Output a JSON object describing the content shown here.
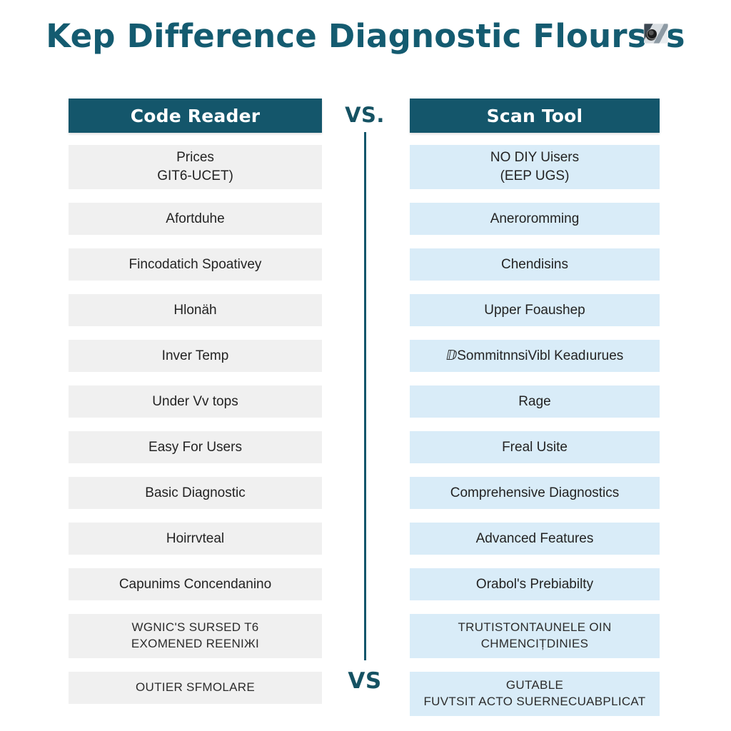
{
  "title": "Kep Difference Diagnostic Flours",
  "title_suffix": "s",
  "title_icon": "scan-tool-photo-icon",
  "center": {
    "vs_top": "VS.",
    "vs_bottom": "VS"
  },
  "colors": {
    "header_teal": "#14566b",
    "title_teal": "#145b70",
    "left_row_bg": "#f0f0f0",
    "right_row_bg": "#d9ecf8",
    "divider": "#14566b",
    "page_bg": "#ffffff",
    "row_text": "#232323"
  },
  "columns": {
    "left": {
      "header": "Code Reader",
      "rows": [
        {
          "line1": "Prices",
          "line2": "GIT6-UCET)",
          "two_line": true,
          "caps": false
        },
        {
          "line1": "Afortduhe",
          "two_line": false,
          "caps": false
        },
        {
          "line1": "Fincodatich Spoativey",
          "two_line": false,
          "caps": false
        },
        {
          "line1": "Hlonäh",
          "two_line": false,
          "caps": false
        },
        {
          "line1": "Inver Temp",
          "two_line": false,
          "caps": false
        },
        {
          "line1": "Under Vv tops",
          "two_line": false,
          "caps": false
        },
        {
          "line1": "Easy For Users",
          "two_line": false,
          "caps": false
        },
        {
          "line1": "Basic Diagnostic",
          "two_line": false,
          "caps": false
        },
        {
          "line1": "Hoirrvteal",
          "two_line": false,
          "caps": false
        },
        {
          "line1": "Capunims Concendanino",
          "two_line": false,
          "caps": false
        },
        {
          "line1": "WGNIC'S SURSED T6",
          "line2": "EXOMENED REENIЖI",
          "two_line": true,
          "caps": true
        },
        {
          "line1": "OUTIER SFMOLARE",
          "two_line": false,
          "caps": true
        }
      ]
    },
    "right": {
      "header": "Scan Tool",
      "rows": [
        {
          "line1": "NO DIY Uisers",
          "line2": "(EEP UGS)",
          "two_line": true,
          "caps": false
        },
        {
          "line1": "Aneroromming",
          "two_line": false,
          "caps": false
        },
        {
          "line1": "Chendisins",
          "two_line": false,
          "caps": false
        },
        {
          "line1": "Upper Foaushep",
          "two_line": false,
          "caps": false
        },
        {
          "line1": "ⅅSommitnnsiVibl Keadıurues",
          "two_line": false,
          "caps": false
        },
        {
          "line1": "Rage",
          "two_line": false,
          "caps": false
        },
        {
          "line1": "Freal Usite",
          "two_line": false,
          "caps": false
        },
        {
          "line1": "Comprehensive Diagnostics",
          "two_line": false,
          "caps": false
        },
        {
          "line1": "Advanced Features",
          "two_line": false,
          "caps": false
        },
        {
          "line1": "Orabol's Prebiabilty",
          "two_line": false,
          "caps": false
        },
        {
          "line1": "TRUTISTONTAUNELE OIN",
          "line2": "CHMENCIȚDINIES",
          "two_line": true,
          "caps": true
        },
        {
          "line1": "GUTABLE",
          "line2": "FUVTSIT ACTO SUERNECUABPLICAT",
          "two_line": true,
          "caps": true
        }
      ]
    }
  }
}
